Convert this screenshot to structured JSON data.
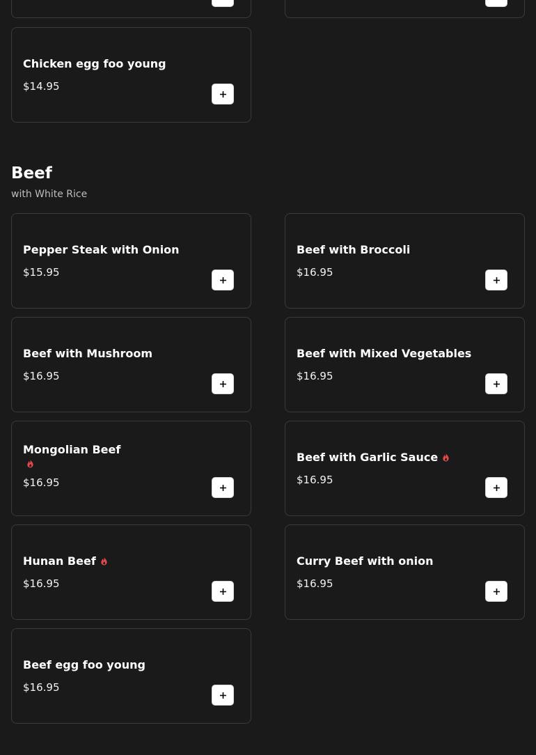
{
  "prev_section": {
    "items": [
      {
        "name": "Chicken egg foo young",
        "price": "$14.95"
      }
    ]
  },
  "beef_section": {
    "title": "Beef",
    "subtitle": "with White Rice",
    "items": [
      {
        "name": "Pepper Steak with Onion",
        "price": "$15.95",
        "spicy": false
      },
      {
        "name": "Beef with Broccoli",
        "price": "$16.95",
        "spicy": false
      },
      {
        "name": "Beef with Mushroom",
        "price": "$16.95",
        "spicy": false
      },
      {
        "name": "Beef with Mixed Vegetables",
        "price": "$16.95",
        "spicy": false
      },
      {
        "name": "Mongolian Beef",
        "price": "$16.95",
        "spicy": true
      },
      {
        "name": "Beef with Garlic Sauce",
        "price": "$16.95",
        "spicy": true
      },
      {
        "name": "Hunan Beef",
        "price": "$16.95",
        "spicy": true
      },
      {
        "name": "Curry Beef with onion",
        "price": "$16.95",
        "spicy": false
      },
      {
        "name": "Beef egg foo young",
        "price": "$16.95",
        "spicy": false
      }
    ]
  },
  "icons": {
    "add": "plus-icon",
    "spicy": "flame-icon"
  },
  "colors": {
    "background": "#1a1a1a",
    "card_border": "#3b3b3b",
    "spicy": "#e5484d",
    "button": "#ffffff"
  }
}
